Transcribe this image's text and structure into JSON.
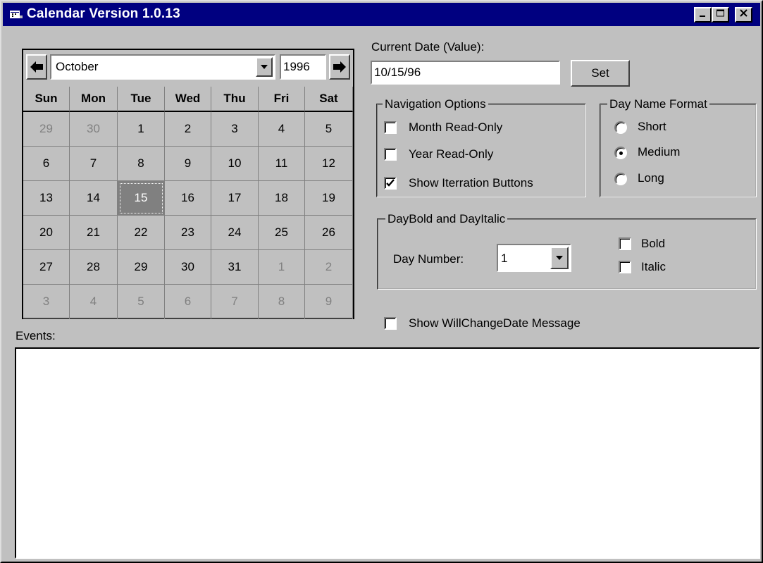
{
  "window": {
    "title": "Calendar Version 1.0.13",
    "controls": {
      "minimize": "_",
      "maximize": "□",
      "close": "✕"
    }
  },
  "calendar": {
    "month": "October",
    "year": "1996",
    "day_headers": [
      "Sun",
      "Mon",
      "Tue",
      "Wed",
      "Thu",
      "Fri",
      "Sat"
    ],
    "weeks": [
      [
        "29",
        "30",
        "1",
        "2",
        "3",
        "4",
        "5"
      ],
      [
        "6",
        "7",
        "8",
        "9",
        "10",
        "11",
        "12"
      ],
      [
        "13",
        "14",
        "15",
        "16",
        "17",
        "18",
        "19"
      ],
      [
        "20",
        "21",
        "22",
        "23",
        "24",
        "25",
        "26"
      ],
      [
        "27",
        "28",
        "29",
        "30",
        "31",
        "1",
        "2"
      ],
      [
        "3",
        "4",
        "5",
        "6",
        "7",
        "8",
        "9"
      ]
    ],
    "selected_day": "15"
  },
  "current_date": {
    "label": "Current Date (Value):",
    "value": "10/15/96",
    "set_button": "Set"
  },
  "navigation_options": {
    "title": "Navigation Options",
    "items": [
      {
        "label": "Month Read-Only",
        "checked": false
      },
      {
        "label": "Year Read-Only",
        "checked": false
      },
      {
        "label": "Show Iterration Buttons",
        "checked": true
      }
    ]
  },
  "day_name_format": {
    "title": "Day Name Format",
    "options": [
      {
        "label": "Short",
        "selected": false
      },
      {
        "label": "Medium",
        "selected": true
      },
      {
        "label": "Long",
        "selected": false
      }
    ]
  },
  "daybold": {
    "title": "DayBold and DayItalic",
    "day_number_label": "Day Number:",
    "day_number_value": "1",
    "bold_label": "Bold",
    "italic_label": "Italic"
  },
  "will_change": {
    "label": "Show WillChangeDate Message",
    "checked": false
  },
  "events": {
    "label": "Events:"
  }
}
